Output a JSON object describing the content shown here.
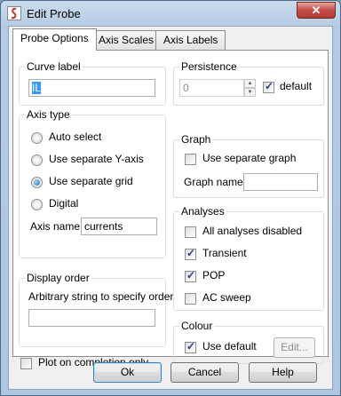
{
  "window": {
    "title": "Edit Probe",
    "close_glyph": "✕"
  },
  "tabs": [
    {
      "label": "Probe Options",
      "active": true
    },
    {
      "label": "Axis Scales",
      "active": false
    },
    {
      "label": "Axis Labels",
      "active": false
    }
  ],
  "curve_label": {
    "title": "Curve label",
    "value": "IL"
  },
  "axis_type": {
    "title": "Axis type",
    "options": [
      {
        "label": "Auto select",
        "selected": false
      },
      {
        "label": "Use separate Y-axis",
        "selected": false
      },
      {
        "label": "Use separate grid",
        "selected": true
      },
      {
        "label": "Digital",
        "selected": false
      }
    ],
    "axis_name_label": "Axis name",
    "axis_name_value": "currents"
  },
  "display_order": {
    "title": "Display order",
    "description": "Arbitrary string to specify order",
    "value": ""
  },
  "plot_on_completion": {
    "label": "Plot on completion only",
    "checked": false
  },
  "persistence": {
    "title": "Persistence",
    "value": "0",
    "default_label": "default",
    "default_checked": true
  },
  "graph": {
    "title": "Graph",
    "separate_label": "Use separate graph",
    "separate_checked": false,
    "name_label": "Graph name",
    "name_value": ""
  },
  "analyses": {
    "title": "Analyses",
    "items": [
      {
        "label": "All analyses disabled",
        "checked": false
      },
      {
        "label": "Transient",
        "checked": true
      },
      {
        "label": "POP",
        "checked": true
      },
      {
        "label": "AC sweep",
        "checked": false
      }
    ]
  },
  "colour": {
    "title": "Colour",
    "use_default_label": "Use default",
    "use_default_checked": true,
    "edit_label": "Edit..."
  },
  "buttons": {
    "ok": "Ok",
    "cancel": "Cancel",
    "help": "Help"
  }
}
